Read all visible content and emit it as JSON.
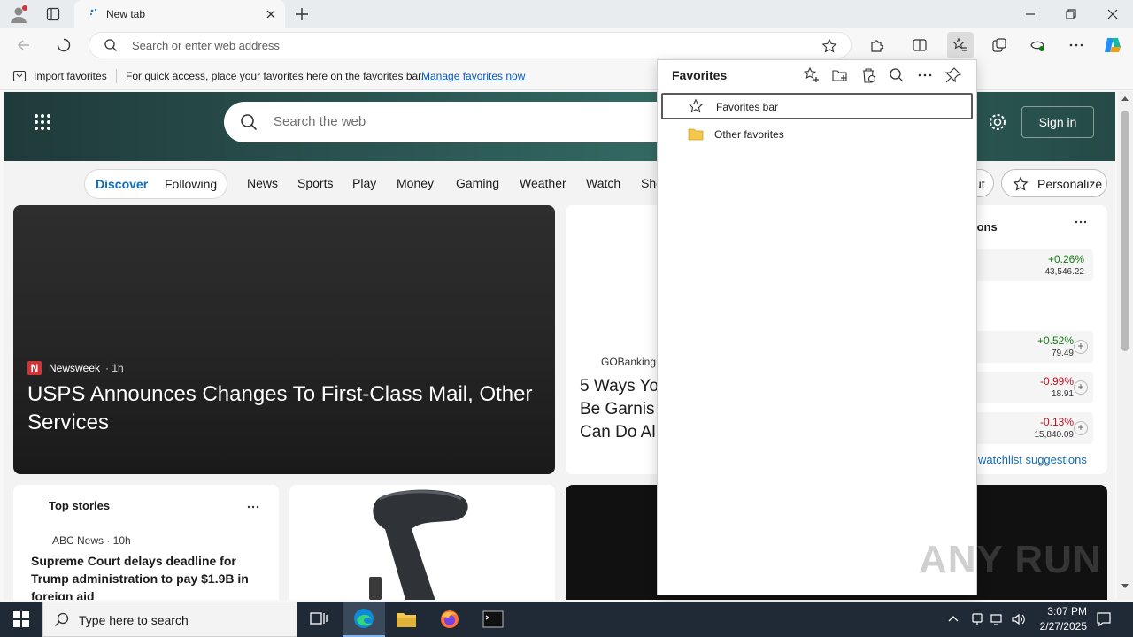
{
  "colors": {
    "accent": "#0078d4",
    "link": "#0a58ca",
    "positive": "#107c10",
    "negative": "#c50f1f",
    "folder": "#f2c94c",
    "taskbar": "#1f2a36"
  },
  "browser": {
    "tab_title": "New tab",
    "omnibox_placeholder": "Search or enter web address"
  },
  "favorites_bar": {
    "import_label": "Import favorites",
    "message": "For quick access, place your favorites here on the favorites bar.",
    "manage_link": "Manage favorites now"
  },
  "favorites_panel": {
    "title": "Favorites",
    "items": [
      {
        "label": "Favorites bar",
        "icon": "star-outline-icon"
      },
      {
        "label": "Other favorites",
        "icon": "folder-icon"
      }
    ]
  },
  "newtab": {
    "search_placeholder": "Search the web",
    "signin_label": "Sign in",
    "nav": {
      "discover": "Discover",
      "following": "Following",
      "items": [
        "News",
        "Sports",
        "Play",
        "Money",
        "Gaming",
        "Weather",
        "Watch",
        "Sho"
      ],
      "partial_button": "ut",
      "personalize": "Personalize"
    },
    "main_story": {
      "source": "Newsweek",
      "age": "· 1h",
      "headline": "USPS Announces Changes To First-Class Mail, Other Services"
    },
    "mid_story": {
      "source": "GOBankingR",
      "headline": "5 Ways Yo\nBe Garnis\nCan Do Al"
    },
    "markets": {
      "title_fragment": "ions",
      "rows": [
        {
          "change": "+0.26%",
          "value": "43,546.22",
          "dir": "up",
          "add": false
        },
        {
          "change": "+0.52%",
          "value": "79.49",
          "dir": "up",
          "add": true
        },
        {
          "change": "-0.99%",
          "value": "18.91",
          "dir": "down",
          "add": true
        },
        {
          "change": "-0.13%",
          "value": "15,840.09",
          "dir": "down",
          "add": true
        }
      ],
      "footer_link": "watchlist suggestions"
    },
    "top_stories": {
      "title": "Top stories",
      "source": "ABC News · 10h",
      "headline": "Supreme Court delays deadline for Trump administration to pay $1.9B in foreign aid"
    }
  },
  "taskbar": {
    "search_placeholder": "Type here to search",
    "time": "3:07 PM",
    "date": "2/27/2025"
  },
  "watermark": "ANY RUN"
}
